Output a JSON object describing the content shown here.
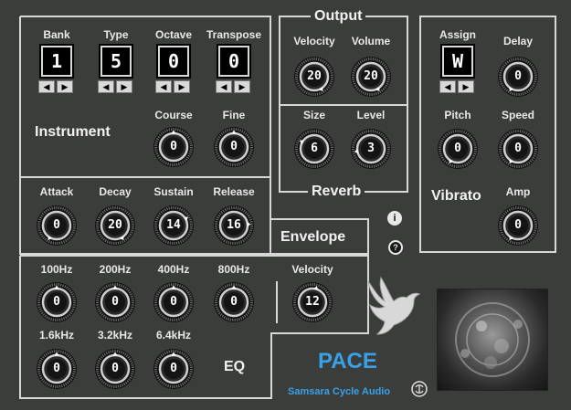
{
  "instrument": {
    "title": "Instrument",
    "displays": [
      {
        "label": "Bank",
        "value": "1"
      },
      {
        "label": "Type",
        "value": "5"
      },
      {
        "label": "Octave",
        "value": "0"
      },
      {
        "label": "Transpose",
        "value": "0"
      }
    ],
    "knobs": [
      {
        "label": "Course",
        "value": "0"
      },
      {
        "label": "Fine",
        "value": "0"
      }
    ]
  },
  "output": {
    "title": "Output",
    "knobs": [
      {
        "label": "Velocity",
        "value": "20"
      },
      {
        "label": "Volume",
        "value": "20"
      }
    ]
  },
  "reverb": {
    "title": "Reverb",
    "knobs": [
      {
        "label": "Size",
        "value": "6"
      },
      {
        "label": "Level",
        "value": "3"
      }
    ]
  },
  "vibrato": {
    "title": "Vibrato",
    "assign": {
      "label": "Assign",
      "value": "W"
    },
    "knobs": [
      {
        "label": "Delay",
        "value": "0"
      },
      {
        "label": "Pitch",
        "value": "0"
      },
      {
        "label": "Speed",
        "value": "0"
      },
      {
        "label": "Amp",
        "value": "0"
      }
    ]
  },
  "envelope": {
    "title": "Envelope",
    "knobs": [
      {
        "label": "Attack",
        "value": "0"
      },
      {
        "label": "Decay",
        "value": "20"
      },
      {
        "label": "Sustain",
        "value": "14"
      },
      {
        "label": "Release",
        "value": "16"
      }
    ]
  },
  "eq": {
    "title": "EQ",
    "knobs": [
      {
        "label": "100Hz",
        "value": "0"
      },
      {
        "label": "200Hz",
        "value": "0"
      },
      {
        "label": "400Hz",
        "value": "0"
      },
      {
        "label": "800Hz",
        "value": "0"
      },
      {
        "label": "1.6kHz",
        "value": "0"
      },
      {
        "label": "3.2kHz",
        "value": "0"
      },
      {
        "label": "6.4kHz",
        "value": "0"
      }
    ],
    "velocity": {
      "label": "Velocity",
      "value": "12"
    }
  },
  "info_button": "i",
  "help_button": "?",
  "product_name": "PACE",
  "brand": "Samsara Cycle Audio",
  "arrow_left": "◀",
  "arrow_right": "▶",
  "colors": {
    "background": "#3b3d3a",
    "accent": "#3aa0e8",
    "frame": "#d8d8d8"
  },
  "icons": [
    "dove-icon",
    "samsara-logo-icon",
    "info-icon",
    "help-icon"
  ]
}
